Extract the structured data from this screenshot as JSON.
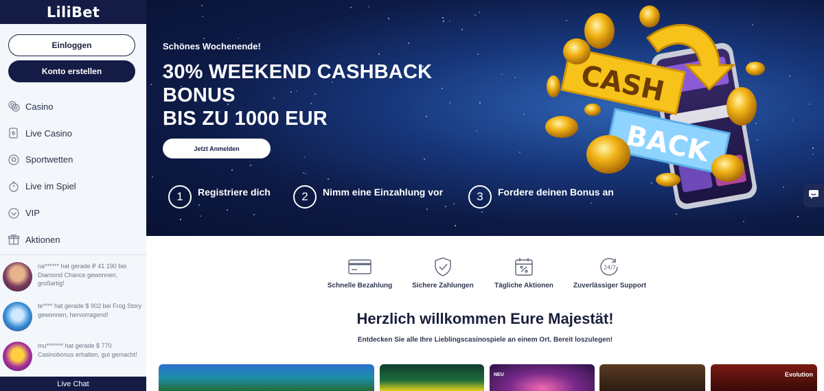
{
  "brand": {
    "logo": "LiliBet"
  },
  "auth": {
    "login_label": "Einloggen",
    "register_label": "Konto erstellen"
  },
  "nav": [
    {
      "label": "Casino",
      "icon": "chips-icon"
    },
    {
      "label": "Live Casino",
      "icon": "cards-icon"
    },
    {
      "label": "Sportwetten",
      "icon": "football-icon"
    },
    {
      "label": "Live im Spiel",
      "icon": "stopwatch-icon"
    },
    {
      "label": "VIP",
      "icon": "vip-icon"
    },
    {
      "label": "Aktionen",
      "icon": "gift-icon"
    }
  ],
  "winners": [
    {
      "text": "na****** hat gerade ₽ 41 190 bei Diamond Chance gewonnen, großartig!"
    },
    {
      "text": "te**** hat gerade $ 902 bei Frog Story gewonnen, hervorragend!"
    },
    {
      "text": "mu******* hat gerade $ 770 Casinobonus erhalten, gut gemacht!"
    }
  ],
  "live_chat_label": "Live Chat",
  "hero": {
    "subtitle": "Schönes Wochenende!",
    "title_lines": [
      "30% WEEKEND CASHBACK",
      "BONUS",
      "BIS ZU 1000 EUR"
    ],
    "cta_label": "Jetzt Anmelden",
    "art_text": [
      "CASH",
      "BACK"
    ],
    "steps": [
      {
        "num": "1",
        "label": "Registriere dich"
      },
      {
        "num": "2",
        "label": "Nimm eine Einzahlung vor"
      },
      {
        "num": "3",
        "label": "Fordere deinen Bonus an"
      }
    ]
  },
  "features": [
    {
      "label": "Schnelle Bezahlung",
      "icon": "credit-card-icon"
    },
    {
      "label": "Sichere Zahlungen",
      "icon": "shield-check-icon"
    },
    {
      "label": "Tägliche Aktionen",
      "icon": "calendar-percent-icon"
    },
    {
      "label": "Zuverlässiger Support",
      "icon": "support-24-7-icon",
      "icon_text": "24/7"
    }
  ],
  "welcome": {
    "title": "Herzlich willkommen Eure Majestät!",
    "subtitle": "Entdecken Sie alle Ihre Lieblingscasinospiele an einem Ort. Bereit loszulegen!"
  },
  "games": [
    {
      "badge": "",
      "brand": ""
    },
    {
      "badge": "",
      "brand": ""
    },
    {
      "badge": "NEU",
      "brand": ""
    },
    {
      "badge": "",
      "brand": ""
    },
    {
      "badge": "",
      "brand": "Evolution"
    }
  ],
  "colors": {
    "navy": "#141b45",
    "sidebar_bg": "#f3f7fb",
    "gold": "#f2b418",
    "cash_yellow": "#f7c21a",
    "back_blue": "#8fd3ff"
  }
}
